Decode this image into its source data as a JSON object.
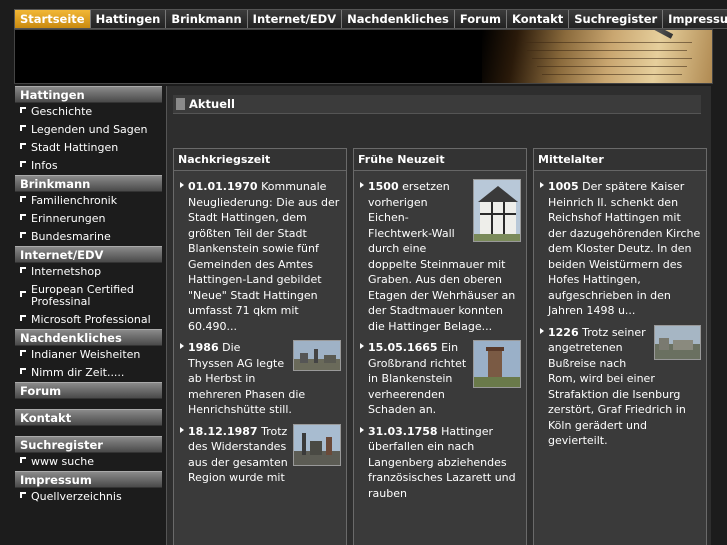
{
  "topnav": [
    "Startseite",
    "Hattingen",
    "Brinkmann",
    "Internet/EDV",
    "Nachdenkliches",
    "Forum",
    "Kontakt",
    "Suchregister",
    "Impressum"
  ],
  "sidebar": {
    "hattingen": {
      "title": "Hattingen",
      "items": [
        "Geschichte",
        "Legenden und Sagen",
        "Stadt Hattingen",
        "Infos"
      ]
    },
    "brinkmann": {
      "title": "Brinkmann",
      "items": [
        "Familienchronik",
        "Erinnerungen",
        "Bundesmarine"
      ]
    },
    "internet": {
      "title": "Internet/EDV",
      "items": [
        "Internetshop",
        "European Certified Professinal",
        "Microsoft Professional"
      ]
    },
    "nachdenkliches": {
      "title": "Nachdenkliches",
      "items": [
        "Indianer Weisheiten",
        "Nimm dir Zeit....."
      ]
    },
    "forum": {
      "title": "Forum"
    },
    "kontakt": {
      "title": "Kontakt"
    },
    "suchregister": {
      "title": "Suchregister",
      "items": [
        "www suche"
      ]
    },
    "impressum": {
      "title": "Impressum",
      "items": [
        "Quellverzeichnis"
      ]
    }
  },
  "main": {
    "section_title": "Aktuell",
    "columns": [
      {
        "title": "Nachkriegszeit",
        "entries": [
          {
            "date": "01.01.1970",
            "text": "Kommunale Neugliederung: Die aus der Stadt Hattingen, dem größten Teil der Stadt Blankenstein sowie fünf Gemeinden des Amtes Hattingen-Land gebildet \"Neue\" Stadt Hattingen umfasst 71 qkm mit 60.490..."
          },
          {
            "date": "1986",
            "text": "Die Thyssen AG legte ab Herbst in mehreren Phasen die Henrichshütte still."
          },
          {
            "date": "18.12.1987",
            "text": "Trotz des Widerstandes aus der gesamten Region wurde mit"
          }
        ]
      },
      {
        "title": "Frühe Neuzeit",
        "entries": [
          {
            "date": "1500",
            "text": "ersetzen vorherigen Eichen-Flechtwerk-Wall durch eine doppelte Steinmauer mit Graben. Aus den oberen Etagen der Wehrhäuser an der Stadtmauer konnten die Hattinger Belage..."
          },
          {
            "date": "15.05.1665",
            "text": "Ein Großbrand richtet in Blankenstein verheerenden Schaden an."
          },
          {
            "date": "31.03.1758",
            "text": "Hattinger überfallen ein nach Langenberg abziehendes französisches Lazarett und rauben"
          }
        ]
      },
      {
        "title": "Mittelalter",
        "entries": [
          {
            "date": "1005",
            "text": "Der spätere Kaiser Heinrich II. schenkt den Reichshof Hattingen mit der dazugehörenden Kirche dem Kloster Deutz. In den beiden Weistürmern des Hofes Hattingen, aufgeschrieben in den Jahren 1498 u..."
          },
          {
            "date": "1226",
            "text": "Trotz seiner angetretenen Bußreise nach Rom, wird bei einer Strafaktion die Isenburg zerstört, Graf Friedrich in Köln gerädert und gevierteilt."
          }
        ]
      }
    ]
  }
}
